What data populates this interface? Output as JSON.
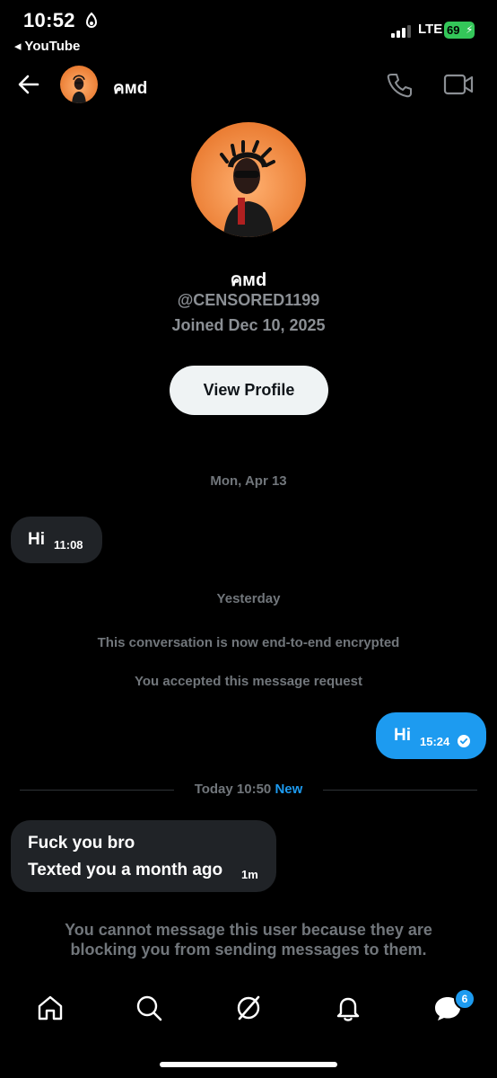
{
  "status_bar": {
    "time": "10:52",
    "back_app": "◂ YouTube",
    "network": "LTE",
    "battery": "69"
  },
  "header": {
    "name": "คмd"
  },
  "profile": {
    "name": "คмd",
    "handle": "@CENSORED1199",
    "joined": "Joined Dec 10, 2025",
    "view_profile_label": "View Profile"
  },
  "conversation": {
    "date1": "Mon, Apr 13",
    "msg1": {
      "text": "Hi",
      "time": "11:08"
    },
    "date2": "Yesterday",
    "system1": "This conversation is now end-to-end encrypted",
    "system2": "You accepted this message request",
    "msg2": {
      "text": "Hi",
      "time": "15:24"
    },
    "date3": "Today 10:50",
    "new_label": "New",
    "msg3": {
      "line1": "Fuck you bro",
      "line2": "Texted you a month ago",
      "time": "1m"
    },
    "blocked_notice": "You cannot message this user because they are blocking you from sending messages to them."
  },
  "nav": {
    "messages_badge": "6"
  },
  "colors": {
    "accent": "#1d9bf0",
    "muted": "#71767b",
    "bubble_in": "#202327",
    "battery": "#34c759"
  }
}
